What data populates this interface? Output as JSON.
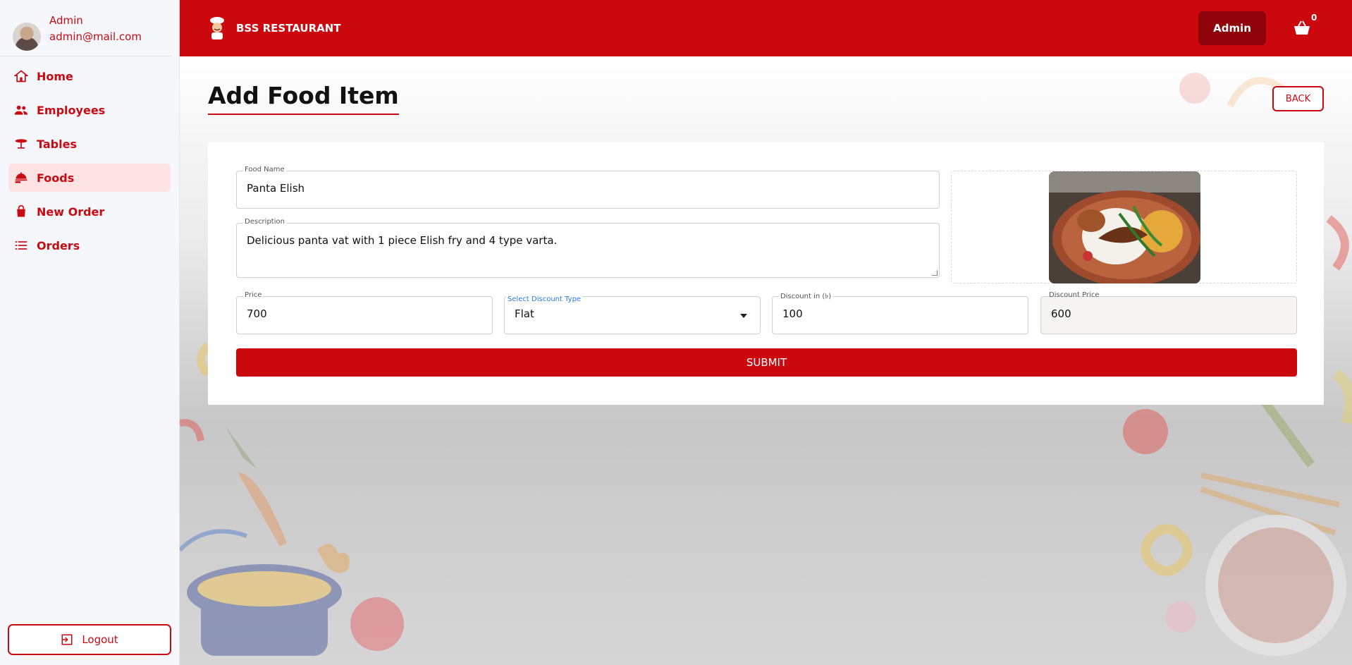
{
  "user": {
    "name": "Admin",
    "email": "admin@mail.com"
  },
  "nav": [
    {
      "label": "Home",
      "icon": "home-icon"
    },
    {
      "label": "Employees",
      "icon": "users-icon"
    },
    {
      "label": "Tables",
      "icon": "table-icon"
    },
    {
      "label": "Foods",
      "icon": "food-icon",
      "active": true
    },
    {
      "label": "New Order",
      "icon": "bag-icon"
    },
    {
      "label": "Orders",
      "icon": "list-icon"
    }
  ],
  "logout_label": "Logout",
  "topbar": {
    "brand": "BSS RESTAURANT",
    "admin_button": "Admin",
    "cart_count": "0"
  },
  "page": {
    "title": "Add Food Item",
    "back_label": "BACK"
  },
  "form": {
    "food_name": {
      "label": "Food Name",
      "value": "Panta Elish"
    },
    "description": {
      "label": "Description",
      "value": "Delicious panta vat with 1 piece Elish fry and 4 type varta."
    },
    "price": {
      "label": "Price",
      "value": "700"
    },
    "discount_type": {
      "label": "Select Discount Type",
      "value": "Flat"
    },
    "discount": {
      "label": "Discount in (৳)",
      "value": "100"
    },
    "discount_price": {
      "label": "Discount Price",
      "value": "600"
    },
    "submit_label": "SUBMIT"
  },
  "colors": {
    "brand_red": "#cc080f",
    "dark_red": "#8e0309",
    "active_bg": "#fde3e4"
  }
}
